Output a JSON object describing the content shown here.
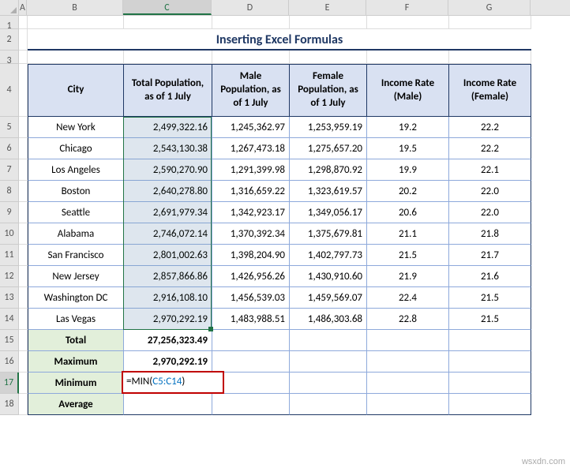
{
  "title": "Inserting Excel Formulas",
  "col_headers": [
    "A",
    "B",
    "C",
    "D",
    "E",
    "F",
    "G"
  ],
  "row_headers": [
    "1",
    "2",
    "3",
    "4",
    "5",
    "6",
    "7",
    "8",
    "9",
    "10",
    "11",
    "12",
    "13",
    "14",
    "15",
    "16",
    "17",
    "18"
  ],
  "active_col": "C",
  "active_row": "17",
  "table": {
    "headers": {
      "city": "City",
      "total_pop": "Total Population, as of 1 July",
      "male_pop": "Male Population, as of 1 July",
      "female_pop": "Female Population, as of 1 July",
      "income_male": "Income Rate (Male)",
      "income_female": "Income Rate (Female)"
    },
    "rows": [
      {
        "city": "New York",
        "total": "2,499,322.16",
        "male": "1,245,362.97",
        "female": "1,253,959.19",
        "im": "19.2",
        "if": "22.2"
      },
      {
        "city": "Chicago",
        "total": "2,543,130.38",
        "male": "1,267,473.18",
        "female": "1,275,657.20",
        "im": "19.5",
        "if": "22.2"
      },
      {
        "city": "Los Angeles",
        "total": "2,590,270.90",
        "male": "1,291,399.98",
        "female": "1,298,870.92",
        "im": "19.9",
        "if": "22.1"
      },
      {
        "city": "Boston",
        "total": "2,640,278.80",
        "male": "1,316,659.22",
        "female": "1,323,619.57",
        "im": "20.2",
        "if": "22.0"
      },
      {
        "city": "Seattle",
        "total": "2,691,979.34",
        "male": "1,342,923.17",
        "female": "1,349,056.17",
        "im": "20.6",
        "if": "22.0"
      },
      {
        "city": "Alabama",
        "total": "2,746,072.14",
        "male": "1,370,392.34",
        "female": "1,375,679.81",
        "im": "21.1",
        "if": "21.8"
      },
      {
        "city": "San Francisco",
        "total": "2,801,002.63",
        "male": "1,398,204.90",
        "female": "1,402,797.73",
        "im": "21.5",
        "if": "21.7"
      },
      {
        "city": "New Jersey",
        "total": "2,857,866.86",
        "male": "1,426,956.26",
        "female": "1,430,910.60",
        "im": "21.9",
        "if": "21.6"
      },
      {
        "city": "Washington DC",
        "total": "2,916,108.10",
        "male": "1,456,539.03",
        "female": "1,459,569.07",
        "im": "22.4",
        "if": "21.5"
      },
      {
        "city": "Las Vegas",
        "total": "2,970,292.19",
        "male": "1,483,988.51",
        "female": "1,486,303.68",
        "im": "22.8",
        "if": "21.5"
      }
    ],
    "summary": {
      "total_label": "Total",
      "total_val": "27,256,323.49",
      "max_label": "Maximum",
      "max_val": "2,970,292.19",
      "min_label": "Minimum",
      "min_formula_prefix": "=MIN(",
      "min_formula_ref": "C5:C14",
      "min_formula_suffix": ")",
      "avg_label": "Average"
    }
  },
  "watermark": "wsxdn.com"
}
